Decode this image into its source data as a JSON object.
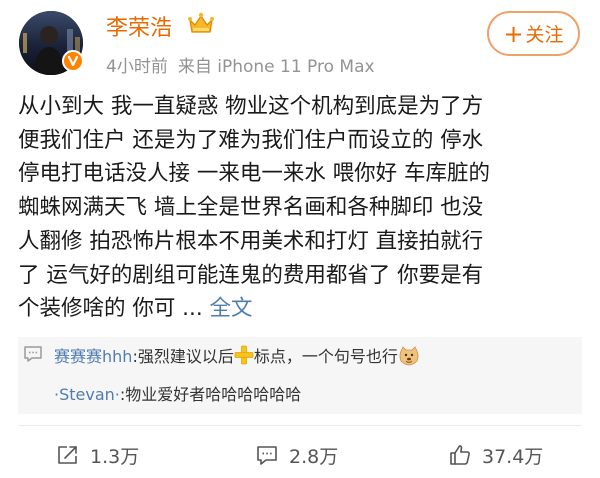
{
  "header": {
    "username": "李荣浩",
    "time": "4小时前",
    "source": "来自 iPhone 11 Pro Max",
    "follow_label": "关注",
    "follow_plus": "+"
  },
  "post": {
    "lines": [
      "从小到大 我一直疑惑 物业这个机构到底是为了方",
      "便我们住户 还是为了难为我们住户而设立的 停水",
      "停电打电话没人接 一来电一来水 喂你好 车库脏的",
      "蜘蛛网满天飞 墙上全是世界名画和各种脚印 也没",
      "人翻修 拍恐怖片根本不用美术和打灯 直接拍就行",
      "了 运气好的剧组可能连鬼的费用都省了 你要是有"
    ],
    "last_line": "个装修啥的 你可 ... ",
    "full_text_link": "全文"
  },
  "comments": [
    {
      "user": "赛赛赛hhh",
      "text_before": ":强烈建议以后",
      "text_after": "标点，一个句号也行"
    },
    {
      "user": "·Stevan·",
      "text": ":物业爱好者哈哈哈哈哈哈"
    }
  ],
  "actions": {
    "repost_count": "1.3万",
    "comment_count": "2.8万",
    "like_count": "37.4万"
  },
  "colors": {
    "username": "#e86a00",
    "link": "#507daf",
    "meta": "#939393",
    "verify_badge": "#ff8200"
  },
  "icons": [
    "crown-icon",
    "verified-badge-icon",
    "comment-bubble-icon",
    "plus-emoji-icon",
    "doge-emoji-icon",
    "repost-icon",
    "comment-icon",
    "like-icon"
  ]
}
